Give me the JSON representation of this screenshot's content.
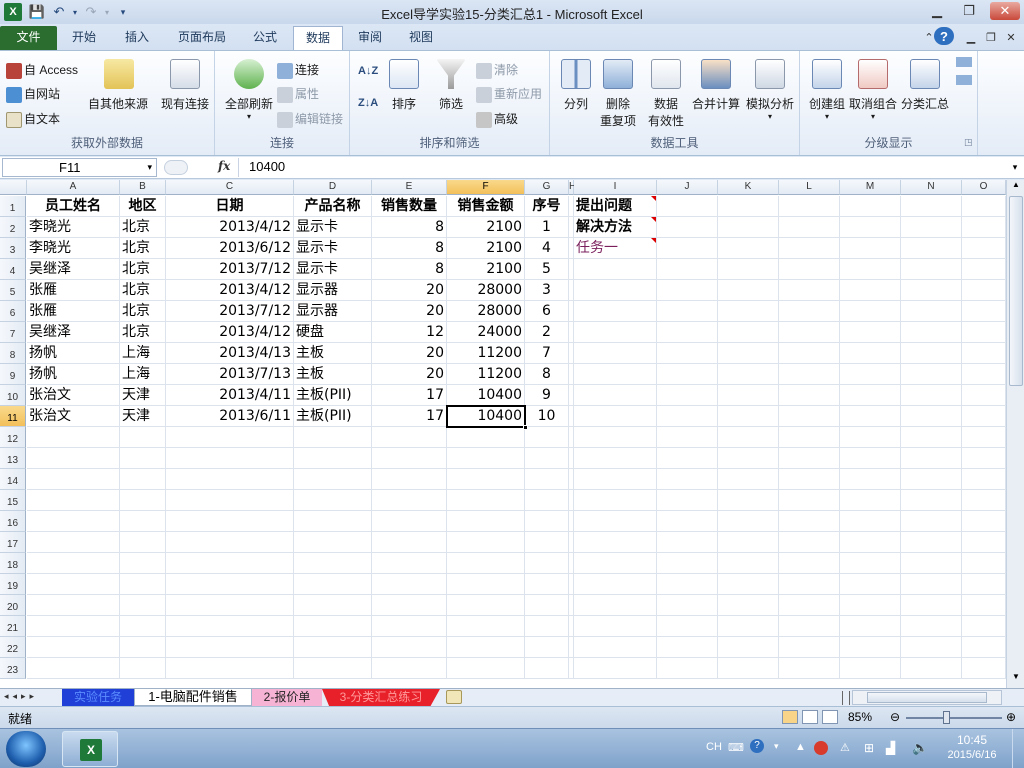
{
  "window": {
    "title": "Excel导学实验15-分类汇总1 - Microsoft Excel"
  },
  "tabs": [
    "文件",
    "开始",
    "插入",
    "页面布局",
    "公式",
    "数据",
    "审阅",
    "视图"
  ],
  "active_tab": "数据",
  "ribbon": {
    "g1": {
      "label": "获取外部数据",
      "access": "自 Access",
      "web": "自网站",
      "text": "自文本",
      "other": "自其他来源",
      "existing": "现有连接"
    },
    "g2": {
      "label": "连接",
      "refresh": "全部刷新",
      "connections": "连接",
      "properties": "属性",
      "edit_links": "编辑链接"
    },
    "g3": {
      "label": "排序和筛选",
      "sort": "排序",
      "filter": "筛选",
      "clear": "清除",
      "reapply": "重新应用",
      "advanced": "高级"
    },
    "g4": {
      "label": "数据工具",
      "split": "分列",
      "remove_dup_1": "删除",
      "remove_dup_2": "重复项",
      "validation_1": "数据",
      "validation_2": "有效性",
      "consolidate": "合并计算",
      "whatif": "模拟分析"
    },
    "g5": {
      "label": "分级显示",
      "group": "创建组",
      "ungroup": "取消组合",
      "subtotal": "分类汇总"
    }
  },
  "formula_bar": {
    "name_box": "F11",
    "fx": "fx",
    "value": "10400"
  },
  "columns": [
    "A",
    "B",
    "C",
    "D",
    "E",
    "F",
    "G",
    "H",
    "I",
    "J",
    "K",
    "L",
    "M",
    "N",
    "O"
  ],
  "rows": [
    "1",
    "2",
    "3",
    "4",
    "5",
    "6",
    "7",
    "8",
    "9",
    "10",
    "11",
    "12",
    "13",
    "14",
    "15",
    "16",
    "17",
    "18",
    "19",
    "20",
    "21",
    "22",
    "23"
  ],
  "table": {
    "headers": [
      "员工姓名",
      "地区",
      "日期",
      "产品名称",
      "销售数量",
      "销售金额",
      "序号"
    ],
    "rows": [
      [
        "李晓光",
        "北京",
        "2013/4/12",
        "显示卡",
        "8",
        "2100",
        "1"
      ],
      [
        "李晓光",
        "北京",
        "2013/6/12",
        "显示卡",
        "8",
        "2100",
        "4"
      ],
      [
        "吴继泽",
        "北京",
        "2013/7/12",
        "显示卡",
        "8",
        "2100",
        "5"
      ],
      [
        "张雁",
        "北京",
        "2013/4/12",
        "显示器",
        "20",
        "28000",
        "3"
      ],
      [
        "张雁",
        "北京",
        "2013/7/12",
        "显示器",
        "20",
        "28000",
        "6"
      ],
      [
        "吴继泽",
        "北京",
        "2013/4/12",
        "硬盘",
        "12",
        "24000",
        "2"
      ],
      [
        "扬帆",
        "上海",
        "2013/4/13",
        "主板",
        "20",
        "11200",
        "7"
      ],
      [
        "扬帆",
        "上海",
        "2013/7/13",
        "主板",
        "20",
        "11200",
        "8"
      ],
      [
        "张治文",
        "天津",
        "2013/4/11",
        "主板(PII)",
        "17",
        "10400",
        "9"
      ],
      [
        "张治文",
        "天津",
        "2013/6/11",
        "主板(PII)",
        "17",
        "10400",
        "10"
      ]
    ]
  },
  "side_notes": {
    "ask": "提出问题",
    "solve": "解决方法",
    "task": "任务一"
  },
  "sheets": [
    "实验任务",
    "1-电脑配件销售",
    "2-报价单",
    "3-分类汇总练习"
  ],
  "status": {
    "ready": "就绪",
    "zoom": "85%"
  },
  "taskbar": {
    "lang": "CH",
    "time": "10:45",
    "date": "2015/6/16"
  },
  "colors": {
    "file_tab": "#2a6d2f",
    "sheet1": "#1f3fd6",
    "sheet2": "#f7b3d3",
    "sheet3": "#e8202a",
    "task_text": "#7a1f5c"
  }
}
